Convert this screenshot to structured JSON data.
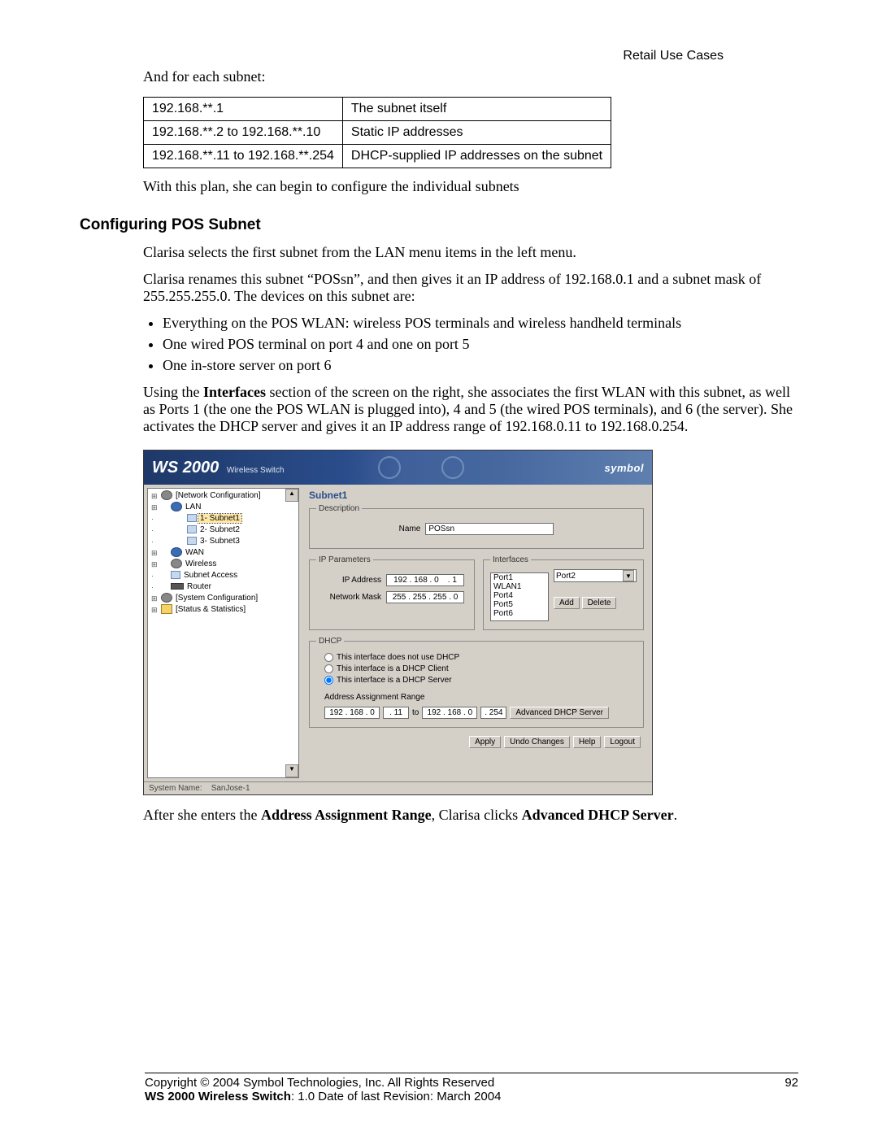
{
  "header": {
    "section": "Retail Use Cases"
  },
  "intro": {
    "lead": "And for each subnet:"
  },
  "ip_table": {
    "rows": [
      {
        "addr": "192.168.**.1",
        "desc": "The subnet itself"
      },
      {
        "addr": "192.168.**.2 to 192.168.**.10",
        "desc": "Static IP addresses"
      },
      {
        "addr": "192.168.**.11 to 192.168.**.254",
        "desc": "DHCP-supplied IP addresses on the subnet"
      }
    ]
  },
  "plan_line": "With this plan, she can begin to configure the individual subnets",
  "section_heading": "Configuring POS Subnet",
  "para1": "Clarisa selects the first subnet from the LAN menu items in the left menu.",
  "para2": "Clarisa renames this subnet “POSsn”, and then gives it an IP address of 192.168.0.1 and a subnet mask of 255.255.255.0. The devices on this subnet are:",
  "bullets": [
    "Everything on the POS WLAN: wireless POS terminals and wireless handheld terminals",
    "One wired POS terminal on port 4 and one on port 5",
    "One in-store server on port 6"
  ],
  "para3_pre": "Using the ",
  "para3_bold": "Interfaces",
  "para3_post": " section of the screen on the right, she associates the first WLAN with this subnet, as well as Ports 1 (the one the POS WLAN is plugged into), 4 and 5 (the wired POS terminals), and 6 (the server). She activates the DHCP server and gives it an IP address range of 192.168.0.11 to 192.168.0.254.",
  "shot": {
    "banner": {
      "product": "WS 2000",
      "subtitle": "Wireless Switch",
      "brand": "symbol"
    },
    "tree": {
      "items": [
        {
          "label": "[Network Configuration]",
          "cls": "root",
          "ico": "gear"
        },
        {
          "label": "LAN",
          "cls": "lvl1",
          "ico": "world"
        },
        {
          "label": "1- Subnet1",
          "cls": "lvl2 sel",
          "ico": "sub"
        },
        {
          "label": "2- Subnet2",
          "cls": "lvl2",
          "ico": "sub"
        },
        {
          "label": "3- Subnet3",
          "cls": "lvl2",
          "ico": "sub"
        },
        {
          "label": "WAN",
          "cls": "lvl1",
          "ico": "world"
        },
        {
          "label": "Wireless",
          "cls": "lvl1",
          "ico": "gear"
        },
        {
          "label": "Subnet Access",
          "cls": "lvl1 leaf",
          "ico": "sub"
        },
        {
          "label": "Router",
          "cls": "lvl1 leaf",
          "ico": "router"
        },
        {
          "label": "[System Configuration]",
          "cls": "root",
          "ico": "gear"
        },
        {
          "label": "[Status & Statistics]",
          "cls": "root",
          "ico": "folder"
        }
      ]
    },
    "panel_title": "Subnet1",
    "desc": {
      "legend": "Description",
      "name_label": "Name",
      "name_value": "POSsn"
    },
    "ip": {
      "legend": "IP Parameters",
      "ip_label": "IP Address",
      "ip_value": "192 . 168 . 0    . 1",
      "mask_label": "Network Mask",
      "mask_value": "255 . 255 . 255 . 0"
    },
    "ifaces": {
      "legend": "Interfaces",
      "selected_left": [
        "Port1",
        "WLAN1",
        "Port4",
        "Port5",
        "Port6"
      ],
      "dropdown_value": "Port2",
      "add": "Add",
      "delete": "Delete"
    },
    "dhcp": {
      "legend": "DHCP",
      "opt_none": "This interface does not use DHCP",
      "opt_client": "This interface is a DHCP Client",
      "opt_server": "This interface is a DHCP Server",
      "range_label": "Address Assignment Range",
      "from_octets": "192 . 168 . 0",
      "from_last": ". 11",
      "to": "to",
      "to_octets": "192 . 168 . 0",
      "to_last": ". 254",
      "adv_btn": "Advanced DHCP Server"
    },
    "buttons": {
      "apply": "Apply",
      "undo": "Undo Changes",
      "help": "Help",
      "logout": "Logout"
    },
    "status": {
      "label": "System Name:",
      "value": "SanJose-1"
    }
  },
  "post_para_pre": "After she enters the ",
  "post_para_b1": "Address Assignment Range",
  "post_para_mid": ", Clarisa clicks ",
  "post_para_b2": "Advanced DHCP Server",
  "post_para_end": ".",
  "footer": {
    "copyright": "Copyright © 2004 Symbol Technologies, Inc. All Rights Reserved",
    "line2_bold": "WS 2000 Wireless Switch",
    "line2_rest": ": 1.0  Date of last Revision: March 2004",
    "pagenum": "92"
  }
}
